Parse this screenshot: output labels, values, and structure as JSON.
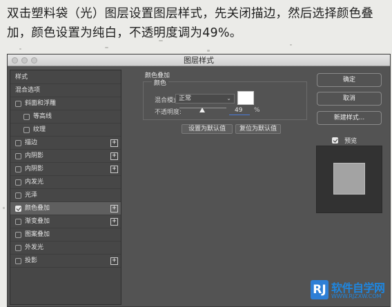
{
  "instruction": "双击塑料袋（光）图层设置图层样式，先关闭描边，然后选择颜色叠加，颜色设置为纯白，不透明度调为49%。",
  "dialog": {
    "title": "图层样式",
    "style_list": [
      {
        "label": "样式",
        "checkbox": false,
        "checked": false,
        "plus": false,
        "selected": false,
        "indent": 0
      },
      {
        "label": "混合选项",
        "checkbox": false,
        "checked": false,
        "plus": false,
        "selected": false,
        "indent": 0
      },
      {
        "label": "斜面和浮雕",
        "checkbox": true,
        "checked": false,
        "plus": false,
        "selected": false,
        "indent": 0
      },
      {
        "label": "等高线",
        "checkbox": true,
        "checked": false,
        "plus": false,
        "selected": false,
        "indent": 1
      },
      {
        "label": "纹理",
        "checkbox": true,
        "checked": false,
        "plus": false,
        "selected": false,
        "indent": 1
      },
      {
        "label": "描边",
        "checkbox": true,
        "checked": false,
        "plus": true,
        "selected": false,
        "indent": 0
      },
      {
        "label": "内阴影",
        "checkbox": true,
        "checked": false,
        "plus": true,
        "selected": false,
        "indent": 0
      },
      {
        "label": "内阴影",
        "checkbox": true,
        "checked": false,
        "plus": true,
        "selected": false,
        "indent": 0
      },
      {
        "label": "内发光",
        "checkbox": true,
        "checked": false,
        "plus": false,
        "selected": false,
        "indent": 0
      },
      {
        "label": "光泽",
        "checkbox": true,
        "checked": false,
        "plus": false,
        "selected": false,
        "indent": 0
      },
      {
        "label": "颜色叠加",
        "checkbox": true,
        "checked": true,
        "plus": true,
        "selected": true,
        "indent": 0
      },
      {
        "label": "渐变叠加",
        "checkbox": true,
        "checked": false,
        "plus": true,
        "selected": false,
        "indent": 0
      },
      {
        "label": "图案叠加",
        "checkbox": true,
        "checked": false,
        "plus": false,
        "selected": false,
        "indent": 0
      },
      {
        "label": "外发光",
        "checkbox": true,
        "checked": false,
        "plus": false,
        "selected": false,
        "indent": 0
      },
      {
        "label": "投影",
        "checkbox": true,
        "checked": false,
        "plus": true,
        "selected": false,
        "indent": 0
      }
    ],
    "color_overlay": {
      "section_title": "颜色叠加",
      "group_label": "颜色",
      "blend_mode_label": "混合模式:",
      "blend_mode_value": "正常",
      "color": "#ffffff",
      "opacity_label": "不透明度:",
      "opacity_value": "49",
      "opacity_unit": "%",
      "opacity_level": 0.49,
      "make_default_label": "设置为默认值",
      "reset_default_label": "复位为默认值"
    },
    "buttons": {
      "ok": "确定",
      "cancel": "取消",
      "new_style": "新建样式...",
      "preview_label": "预览",
      "preview_checked": true
    },
    "preview_color": "#a3a3a3"
  },
  "watermark": {
    "logo": "RJ",
    "title": "软件自学网",
    "url": "WWW.RJZXW.COM"
  }
}
